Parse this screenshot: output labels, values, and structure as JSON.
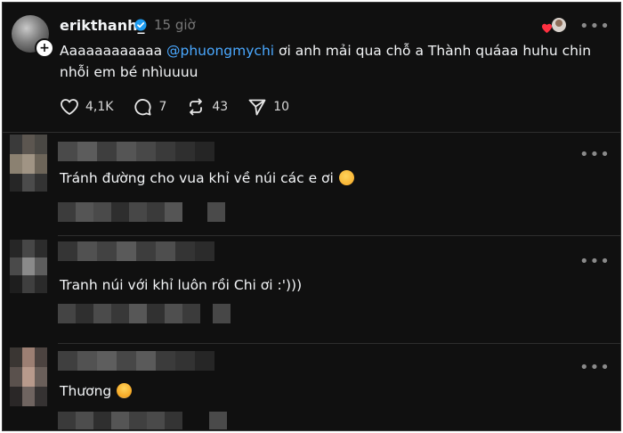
{
  "post": {
    "username": "erikthanh_",
    "time": "15 giờ",
    "text_before": "Aaaaaaaaaaaa ",
    "mention": "@phuongmychi",
    "text_after": " ơi anh mải qua chỗ a Thành quáaa huhu chin nhỗi em bé nhìuuuu",
    "likes": "4,1K",
    "comments": "7",
    "reposts": "43",
    "shares": "10"
  },
  "comments": [
    {
      "text": "Tránh đường cho vua khỉ về núi các e ơi",
      "emoji": "sleepy-face-emoji"
    },
    {
      "text": "Tranh núi với khỉ luôn rồi Chi ơi :')))",
      "emoji": ""
    },
    {
      "text": "Thương",
      "emoji": "crying-face-emoji"
    }
  ],
  "icons": {
    "more": "more-icon",
    "like": "heart-icon",
    "comment": "comment-icon",
    "repost": "repost-icon",
    "share": "send-icon",
    "verified": "verified-badge-icon"
  },
  "colors": {
    "background": "#101010",
    "text": "#f3f5f7",
    "muted": "#777777",
    "mention": "#4aa8ff",
    "verified": "#1d9bf0"
  }
}
